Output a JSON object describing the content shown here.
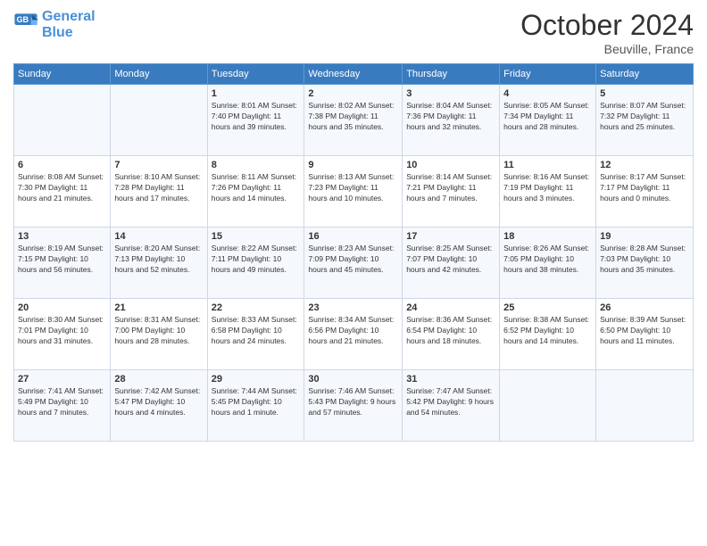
{
  "logo": {
    "line1": "General",
    "line2": "Blue"
  },
  "title": "October 2024",
  "location": "Beuville, France",
  "weekdays": [
    "Sunday",
    "Monday",
    "Tuesday",
    "Wednesday",
    "Thursday",
    "Friday",
    "Saturday"
  ],
  "weeks": [
    [
      {
        "day": "",
        "info": ""
      },
      {
        "day": "",
        "info": ""
      },
      {
        "day": "1",
        "info": "Sunrise: 8:01 AM\nSunset: 7:40 PM\nDaylight: 11 hours and 39 minutes."
      },
      {
        "day": "2",
        "info": "Sunrise: 8:02 AM\nSunset: 7:38 PM\nDaylight: 11 hours and 35 minutes."
      },
      {
        "day": "3",
        "info": "Sunrise: 8:04 AM\nSunset: 7:36 PM\nDaylight: 11 hours and 32 minutes."
      },
      {
        "day": "4",
        "info": "Sunrise: 8:05 AM\nSunset: 7:34 PM\nDaylight: 11 hours and 28 minutes."
      },
      {
        "day": "5",
        "info": "Sunrise: 8:07 AM\nSunset: 7:32 PM\nDaylight: 11 hours and 25 minutes."
      }
    ],
    [
      {
        "day": "6",
        "info": "Sunrise: 8:08 AM\nSunset: 7:30 PM\nDaylight: 11 hours and 21 minutes."
      },
      {
        "day": "7",
        "info": "Sunrise: 8:10 AM\nSunset: 7:28 PM\nDaylight: 11 hours and 17 minutes."
      },
      {
        "day": "8",
        "info": "Sunrise: 8:11 AM\nSunset: 7:26 PM\nDaylight: 11 hours and 14 minutes."
      },
      {
        "day": "9",
        "info": "Sunrise: 8:13 AM\nSunset: 7:23 PM\nDaylight: 11 hours and 10 minutes."
      },
      {
        "day": "10",
        "info": "Sunrise: 8:14 AM\nSunset: 7:21 PM\nDaylight: 11 hours and 7 minutes."
      },
      {
        "day": "11",
        "info": "Sunrise: 8:16 AM\nSunset: 7:19 PM\nDaylight: 11 hours and 3 minutes."
      },
      {
        "day": "12",
        "info": "Sunrise: 8:17 AM\nSunset: 7:17 PM\nDaylight: 11 hours and 0 minutes."
      }
    ],
    [
      {
        "day": "13",
        "info": "Sunrise: 8:19 AM\nSunset: 7:15 PM\nDaylight: 10 hours and 56 minutes."
      },
      {
        "day": "14",
        "info": "Sunrise: 8:20 AM\nSunset: 7:13 PM\nDaylight: 10 hours and 52 minutes."
      },
      {
        "day": "15",
        "info": "Sunrise: 8:22 AM\nSunset: 7:11 PM\nDaylight: 10 hours and 49 minutes."
      },
      {
        "day": "16",
        "info": "Sunrise: 8:23 AM\nSunset: 7:09 PM\nDaylight: 10 hours and 45 minutes."
      },
      {
        "day": "17",
        "info": "Sunrise: 8:25 AM\nSunset: 7:07 PM\nDaylight: 10 hours and 42 minutes."
      },
      {
        "day": "18",
        "info": "Sunrise: 8:26 AM\nSunset: 7:05 PM\nDaylight: 10 hours and 38 minutes."
      },
      {
        "day": "19",
        "info": "Sunrise: 8:28 AM\nSunset: 7:03 PM\nDaylight: 10 hours and 35 minutes."
      }
    ],
    [
      {
        "day": "20",
        "info": "Sunrise: 8:30 AM\nSunset: 7:01 PM\nDaylight: 10 hours and 31 minutes."
      },
      {
        "day": "21",
        "info": "Sunrise: 8:31 AM\nSunset: 7:00 PM\nDaylight: 10 hours and 28 minutes."
      },
      {
        "day": "22",
        "info": "Sunrise: 8:33 AM\nSunset: 6:58 PM\nDaylight: 10 hours and 24 minutes."
      },
      {
        "day": "23",
        "info": "Sunrise: 8:34 AM\nSunset: 6:56 PM\nDaylight: 10 hours and 21 minutes."
      },
      {
        "day": "24",
        "info": "Sunrise: 8:36 AM\nSunset: 6:54 PM\nDaylight: 10 hours and 18 minutes."
      },
      {
        "day": "25",
        "info": "Sunrise: 8:38 AM\nSunset: 6:52 PM\nDaylight: 10 hours and 14 minutes."
      },
      {
        "day": "26",
        "info": "Sunrise: 8:39 AM\nSunset: 6:50 PM\nDaylight: 10 hours and 11 minutes."
      }
    ],
    [
      {
        "day": "27",
        "info": "Sunrise: 7:41 AM\nSunset: 5:49 PM\nDaylight: 10 hours and 7 minutes."
      },
      {
        "day": "28",
        "info": "Sunrise: 7:42 AM\nSunset: 5:47 PM\nDaylight: 10 hours and 4 minutes."
      },
      {
        "day": "29",
        "info": "Sunrise: 7:44 AM\nSunset: 5:45 PM\nDaylight: 10 hours and 1 minute."
      },
      {
        "day": "30",
        "info": "Sunrise: 7:46 AM\nSunset: 5:43 PM\nDaylight: 9 hours and 57 minutes."
      },
      {
        "day": "31",
        "info": "Sunrise: 7:47 AM\nSunset: 5:42 PM\nDaylight: 9 hours and 54 minutes."
      },
      {
        "day": "",
        "info": ""
      },
      {
        "day": "",
        "info": ""
      }
    ]
  ]
}
